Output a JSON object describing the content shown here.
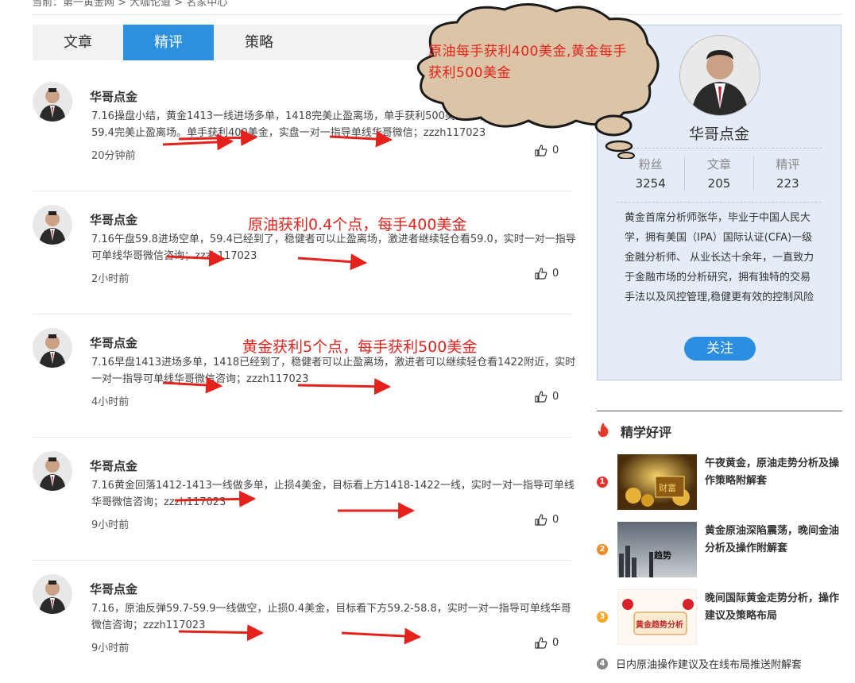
{
  "breadcrumb": "当前：第一黄金网 > 大咖论道 > 名家中心",
  "tabs": [
    {
      "label": "文章",
      "active": false
    },
    {
      "label": "精评",
      "active": true
    },
    {
      "label": "策略",
      "active": false
    }
  ],
  "posts": [
    {
      "name": "华哥点金",
      "text": "7.16操盘小结，黄金1413一线进场多单，1418完美止盈离场，单手获利500美金。原油59.8进场空单，59.4完美止盈离场。单手获利400美金，实盘一对一指导单线华哥微信；zzzh117023",
      "time": "20分钟前",
      "likes": "0"
    },
    {
      "name": "华哥点金",
      "text": "7.16午盘59.8进场空单，59.4已经到了，稳健者可以止盈离场，激进者继续轻仓看59.0，实时一对一指导可单线华哥微信咨询；zzzh117023",
      "time": "2小时前",
      "likes": "0"
    },
    {
      "name": "华哥点金",
      "text": "7.16早盘1413进场多单，1418已经到了，稳健者可以止盈离场，激进者可以继续轻仓看1422附近，实时一对一指导可单线华哥微信咨询；zzzh117023",
      "time": "4小时前",
      "likes": "0"
    },
    {
      "name": "华哥点金",
      "text": "7.16黄金回落1412-1413一线做多单，止损4美金，目标看上方1418-1422一线，实时一对一指导可单线华哥微信咨询；zzzh117023",
      "time": "9小时前",
      "likes": "0"
    },
    {
      "name": "华哥点金",
      "text": "7.16，原油反弹59.7-59.9一线做空，止损0.4美金，目标看下方59.2-58.8，实时一对一指导可单线华哥微信咨询；zzzh117023",
      "time": "9小时前",
      "likes": "0"
    }
  ],
  "annotations": {
    "cloud": "原油每手获利400美金,黄金每手获利500美金",
    "oil": "原油获利0.4个点，每手400美金",
    "gold": "黄金获利5个点，每手获利500美金"
  },
  "profile": {
    "name": "华哥点金",
    "stats": [
      {
        "label": "粉丝",
        "value": "3254"
      },
      {
        "label": "文章",
        "value": "205"
      },
      {
        "label": "精评",
        "value": "223"
      }
    ],
    "bio": "黄金首席分析师张华，毕业于中国人民大学，拥有美国（IPA）国际认证(CFA)一级金融分析师、 从业长达十余年，一直致力于金融市场的分析研究，拥有独特的交易手法以及风控管理,稳健更有效的控制风险",
    "follow_label": "关注"
  },
  "recommend": {
    "title": "精学好评",
    "items": [
      {
        "rank": "1",
        "title": "午夜黄金，原油走势分析及操作策略附解套",
        "color": "#e8302a",
        "thumb_text": "财富"
      },
      {
        "rank": "2",
        "title": "黄金原油深陷震荡，晚间金油分析及操作附解套",
        "color": "#f08a24",
        "thumb_text": "趋势"
      },
      {
        "rank": "3",
        "title": "晚间国际黄金走势分析，操作建议及策略布局",
        "color": "#f5a623",
        "thumb_text": "黄金趋势分析"
      }
    ],
    "fourth": {
      "rank": "4",
      "title": "日内原油操作建议及在线布局推送附解套"
    }
  }
}
